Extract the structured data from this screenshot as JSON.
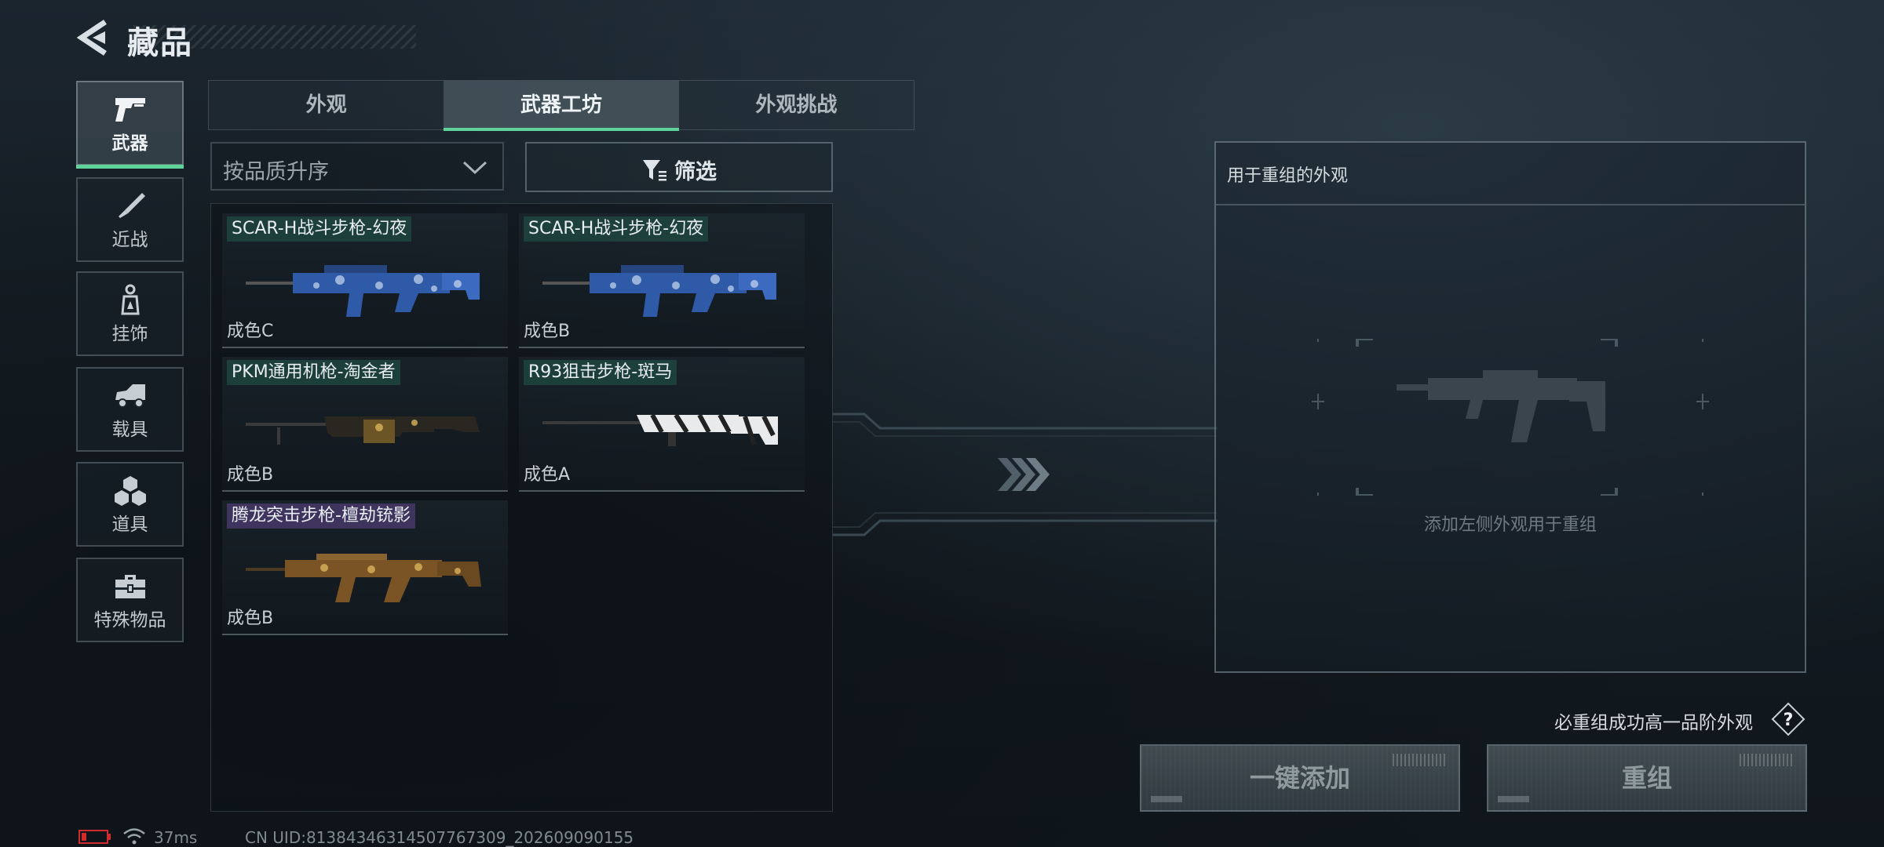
{
  "header": {
    "title": "藏品"
  },
  "nav": {
    "items": [
      {
        "label": "武器",
        "icon": "pistol-icon",
        "active": true
      },
      {
        "label": "近战",
        "icon": "knife-icon",
        "active": false
      },
      {
        "label": "挂饰",
        "icon": "charm-icon",
        "active": false
      },
      {
        "label": "载具",
        "icon": "vehicle-icon",
        "active": false
      },
      {
        "label": "道具",
        "icon": "props-icon",
        "active": false
      },
      {
        "label": "特殊物品",
        "icon": "toolbox-icon",
        "active": false
      }
    ]
  },
  "tabs": [
    {
      "label": "外观",
      "active": false
    },
    {
      "label": "武器工坊",
      "active": true
    },
    {
      "label": "外观挑战",
      "active": false
    }
  ],
  "controls": {
    "sort_label": "按品质升序",
    "filter_label": "筛选"
  },
  "items": [
    {
      "name": "SCAR-H战斗步枪-幻夜",
      "grade": "成色C",
      "skin": "blue-camo"
    },
    {
      "name": "SCAR-H战斗步枪-幻夜",
      "grade": "成色B",
      "skin": "blue-camo"
    },
    {
      "name": "PKM通用机枪-淘金者",
      "grade": "成色B",
      "skin": "gold-dark"
    },
    {
      "name": "R93狙击步枪-斑马",
      "grade": "成色A",
      "skin": "zebra"
    },
    {
      "name": "腾龙突击步枪-檀劫铳影",
      "grade": "成色B",
      "skin": "gold-brown"
    }
  ],
  "recombine": {
    "title": "用于重组的外观",
    "hint": "添加左侧外观用于重组",
    "guarantee": "必重组成功高一品阶外观",
    "add_all_label": "一键添加",
    "recombine_label": "重组"
  },
  "status": {
    "ping": "37ms",
    "uid": "CN UID:81384346314507767309_202609090155"
  },
  "colors": {
    "accent": "#5fd39a",
    "name_tag_green": "#235a4b",
    "name_tag_purple": "#5f468c"
  }
}
